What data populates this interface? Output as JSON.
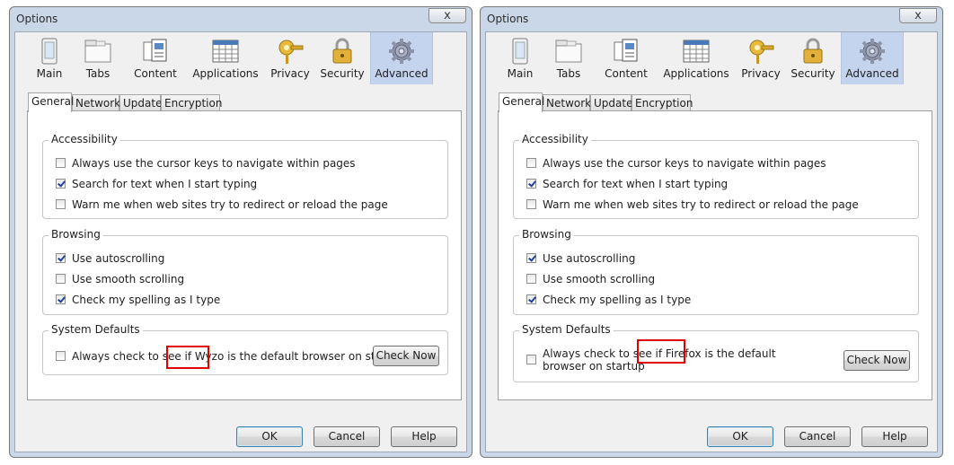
{
  "windows": [
    {
      "title": "Options",
      "close_label": "x",
      "toolbar": [
        {
          "label": "Main",
          "icon": "main-icon"
        },
        {
          "label": "Tabs",
          "icon": "tabs-icon"
        },
        {
          "label": "Content",
          "icon": "content-icon"
        },
        {
          "label": "Applications",
          "icon": "applications-icon"
        },
        {
          "label": "Privacy",
          "icon": "privacy-icon"
        },
        {
          "label": "Security",
          "icon": "security-icon"
        },
        {
          "label": "Advanced",
          "icon": "advanced-icon",
          "selected": true
        }
      ],
      "tabs": [
        "General",
        "Network",
        "Update",
        "Encryption"
      ],
      "accessibility": {
        "title": "Accessibility",
        "items": [
          {
            "label": "Always use the cursor keys to navigate within pages",
            "checked": false
          },
          {
            "label": "Search for text when I start typing",
            "checked": true
          },
          {
            "label": "Warn me when web sites try to redirect or reload the page",
            "checked": false
          }
        ]
      },
      "browsing": {
        "title": "Browsing",
        "items": [
          {
            "label": "Use autoscrolling",
            "checked": true
          },
          {
            "label": "Use smooth scrolling",
            "checked": false
          },
          {
            "label": "Check my spelling as I type",
            "checked": true
          }
        ]
      },
      "system_defaults": {
        "title": "System Defaults",
        "check_label": "Always check to see if Wyzo is the default browser on startup",
        "checked": false,
        "check_now": "Check Now"
      },
      "buttons": {
        "ok": "OK",
        "cancel": "Cancel",
        "help": "Help"
      }
    },
    {
      "title": "Options",
      "close_label": "x",
      "toolbar": [
        {
          "label": "Main",
          "icon": "main-icon"
        },
        {
          "label": "Tabs",
          "icon": "tabs-icon"
        },
        {
          "label": "Content",
          "icon": "content-icon"
        },
        {
          "label": "Applications",
          "icon": "applications-icon"
        },
        {
          "label": "Privacy",
          "icon": "privacy-icon"
        },
        {
          "label": "Security",
          "icon": "security-icon"
        },
        {
          "label": "Advanced",
          "icon": "advanced-icon",
          "selected": true
        }
      ],
      "tabs": [
        "General",
        "Network",
        "Update",
        "Encryption"
      ],
      "accessibility": {
        "title": "Accessibility",
        "items": [
          {
            "label": "Always use the cursor keys to navigate within pages",
            "checked": false
          },
          {
            "label": "Search for text when I start typing",
            "checked": true
          },
          {
            "label": "Warn me when web sites try to redirect or reload the page",
            "checked": false
          }
        ]
      },
      "browsing": {
        "title": "Browsing",
        "items": [
          {
            "label": "Use autoscrolling",
            "checked": true
          },
          {
            "label": "Use smooth scrolling",
            "checked": false
          },
          {
            "label": "Check my spelling as I type",
            "checked": true
          }
        ]
      },
      "system_defaults": {
        "title": "System Defaults",
        "check_label": "Always check to see if Firefox is the default browser on startup",
        "checked": false,
        "check_now": "Check Now"
      },
      "buttons": {
        "ok": "OK",
        "cancel": "Cancel",
        "help": "Help"
      }
    }
  ],
  "colors": {
    "highlight_box": "#e00000",
    "selected_toolbar": "#c4d3ee",
    "window_frame": "#c9d7e8"
  }
}
